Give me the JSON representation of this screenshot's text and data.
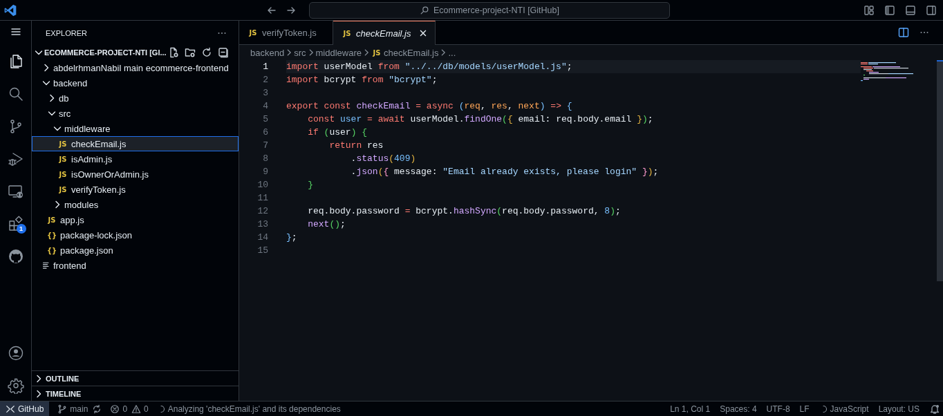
{
  "title_bar": {
    "search": "Ecommerce-project-NTI [GitHub]"
  },
  "activity_bar": {
    "items": [
      {
        "kind": "files",
        "selected": true
      },
      {
        "kind": "search",
        "selected": false
      },
      {
        "kind": "source-control",
        "selected": false
      },
      {
        "kind": "run-debug",
        "selected": false
      },
      {
        "kind": "remote",
        "selected": false
      },
      {
        "kind": "extensions",
        "selected": false,
        "badge": "1"
      },
      {
        "kind": "github",
        "selected": false
      }
    ],
    "bottom": [
      {
        "kind": "account"
      },
      {
        "kind": "settings"
      }
    ]
  },
  "explorer": {
    "title": "EXPLORER",
    "root": {
      "label": "ECOMMERCE-PROJECT-NTI [GI...",
      "expanded": true
    },
    "tree": [
      {
        "label": "abdelrhmanNabil main ecommerce-frontend",
        "kind": "folder",
        "expanded": false,
        "selected": false
      },
      {
        "label": "backend",
        "kind": "folder",
        "expanded": true,
        "selected": false,
        "children": [
          {
            "label": "db",
            "kind": "folder",
            "expanded": false,
            "selected": false
          },
          {
            "label": "src",
            "kind": "folder",
            "expanded": true,
            "selected": false,
            "children": [
              {
                "label": "middleware",
                "kind": "folder",
                "expanded": true,
                "selected": false,
                "children": [
                  {
                    "label": "checkEmail.js",
                    "kind": "file",
                    "icon": "JS",
                    "selected": true
                  },
                  {
                    "label": "isAdmin.js",
                    "kind": "file",
                    "icon": "JS",
                    "selected": false
                  },
                  {
                    "label": "isOwnerOrAdmin.js",
                    "kind": "file",
                    "icon": "JS",
                    "selected": false
                  },
                  {
                    "label": "verifyToken.js",
                    "kind": "file",
                    "icon": "JS",
                    "selected": false
                  }
                ]
              },
              {
                "label": "modules",
                "kind": "folder",
                "expanded": false,
                "selected": false
              }
            ]
          },
          {
            "label": "app.js",
            "kind": "file",
            "icon": "JS",
            "selected": false
          },
          {
            "label": "package-lock.json",
            "kind": "file",
            "icon": "{}",
            "selected": false
          },
          {
            "label": "package.json",
            "kind": "file",
            "icon": "{}",
            "selected": false
          }
        ]
      },
      {
        "label": "frontend",
        "kind": "submodule",
        "selected": false
      }
    ],
    "sections": [
      {
        "label": "OUTLINE",
        "expanded": false
      },
      {
        "label": "TIMELINE",
        "expanded": false
      }
    ]
  },
  "editor": {
    "tabs": [
      {
        "label": "verifyToken.js",
        "icon": "JS",
        "selected": false,
        "preview": false
      },
      {
        "label": "checkEmail.js",
        "icon": "JS",
        "selected": true,
        "preview": true
      }
    ],
    "breadcrumbs": [
      {
        "text": "backend"
      },
      {
        "text": "src"
      },
      {
        "text": "middleware"
      },
      {
        "text": "checkEmail.js",
        "icon": "JS"
      },
      {
        "text": "..."
      }
    ],
    "lines": [
      {
        "number": "1",
        "active": true,
        "tokens": [
          {
            "kind": "kw",
            "text": "import"
          },
          {
            "kind": "plain",
            "text": " userModel "
          },
          {
            "kind": "kw",
            "text": "from"
          },
          {
            "kind": "str",
            "text": " \"../../db/models/userModel.js\""
          },
          {
            "kind": "plain",
            "text": ";"
          }
        ]
      },
      {
        "number": "2",
        "active": false,
        "tokens": [
          {
            "kind": "kw",
            "text": "import"
          },
          {
            "kind": "plain",
            "text": " bcrypt "
          },
          {
            "kind": "kw",
            "text": "from"
          },
          {
            "kind": "str",
            "text": " \"bcrypt\""
          },
          {
            "kind": "plain",
            "text": ";"
          }
        ]
      },
      {
        "number": "3",
        "active": false
      },
      {
        "number": "4",
        "active": false,
        "tokens": [
          {
            "kind": "kw",
            "text": "export"
          },
          {
            "kind": "kw",
            "text": " const"
          },
          {
            "kind": "fn",
            "text": " checkEmail"
          },
          {
            "kind": "kw",
            "text": " ="
          },
          {
            "kind": "kw",
            "text": " async"
          },
          {
            "kind": "b1",
            "text": " ("
          },
          {
            "kind": "param",
            "text": "req"
          },
          {
            "kind": "plain",
            "text": ", "
          },
          {
            "kind": "param",
            "text": "res"
          },
          {
            "kind": "plain",
            "text": ", "
          },
          {
            "kind": "param",
            "text": "next"
          },
          {
            "kind": "b1",
            "text": ")"
          },
          {
            "kind": "kw",
            "text": " =>"
          },
          {
            "kind": "b1",
            "text": " {"
          }
        ]
      },
      {
        "number": "5",
        "active": false,
        "tokens": [
          {
            "kind": "kw",
            "text": "    const"
          },
          {
            "kind": "var",
            "text": " user"
          },
          {
            "kind": "kw",
            "text": " ="
          },
          {
            "kind": "kw",
            "text": " await"
          },
          {
            "kind": "plain",
            "text": " userModel."
          },
          {
            "kind": "fn",
            "text": "findOne"
          },
          {
            "kind": "b2",
            "text": "("
          },
          {
            "kind": "b3",
            "text": "{"
          },
          {
            "kind": "plain",
            "text": " email: req.body.email "
          },
          {
            "kind": "b3",
            "text": "}"
          },
          {
            "kind": "b2",
            "text": ")"
          },
          {
            "kind": "plain",
            "text": ";"
          }
        ]
      },
      {
        "number": "6",
        "active": false,
        "tokens": [
          {
            "kind": "kw",
            "text": "    if"
          },
          {
            "kind": "b2",
            "text": " ("
          },
          {
            "kind": "plain",
            "text": "user"
          },
          {
            "kind": "b2",
            "text": ")"
          },
          {
            "kind": "b2",
            "text": " {"
          }
        ]
      },
      {
        "number": "7",
        "active": false,
        "tokens": [
          {
            "kind": "kw",
            "text": "        return"
          },
          {
            "kind": "plain",
            "text": " res"
          }
        ]
      },
      {
        "number": "8",
        "active": false,
        "tokens": [
          {
            "kind": "plain",
            "text": "            ."
          },
          {
            "kind": "fn",
            "text": "status"
          },
          {
            "kind": "b3",
            "text": "("
          },
          {
            "kind": "num",
            "text": "409"
          },
          {
            "kind": "b3",
            "text": ")"
          }
        ]
      },
      {
        "number": "9",
        "active": false,
        "tokens": [
          {
            "kind": "plain",
            "text": "            ."
          },
          {
            "kind": "fn",
            "text": "json"
          },
          {
            "kind": "b3",
            "text": "("
          },
          {
            "kind": "b4",
            "text": "{"
          },
          {
            "kind": "plain",
            "text": " message: "
          },
          {
            "kind": "str",
            "text": "\"Email already exists, please login\""
          },
          {
            "kind": "b4",
            "text": " }"
          },
          {
            "kind": "b3",
            "text": ")"
          },
          {
            "kind": "plain",
            "text": ";"
          }
        ]
      },
      {
        "number": "10",
        "active": false,
        "tokens": [
          {
            "kind": "b2",
            "text": "    }"
          }
        ]
      },
      {
        "number": "11",
        "active": false
      },
      {
        "number": "12",
        "active": false,
        "tokens": [
          {
            "kind": "plain",
            "text": "    req.body.password "
          },
          {
            "kind": "kw",
            "text": "="
          },
          {
            "kind": "plain",
            "text": " bcrypt."
          },
          {
            "kind": "fn",
            "text": "hashSync"
          },
          {
            "kind": "b2",
            "text": "("
          },
          {
            "kind": "plain",
            "text": "req.body.password, "
          },
          {
            "kind": "num",
            "text": "8"
          },
          {
            "kind": "b2",
            "text": ")"
          },
          {
            "kind": "plain",
            "text": ";"
          }
        ]
      },
      {
        "number": "13",
        "active": false,
        "tokens": [
          {
            "kind": "fn",
            "text": "    next"
          },
          {
            "kind": "b2",
            "text": "()"
          },
          {
            "kind": "plain",
            "text": ";"
          }
        ]
      },
      {
        "number": "14",
        "active": false,
        "tokens": [
          {
            "kind": "b1",
            "text": "}"
          },
          {
            "kind": "plain",
            "text": ";"
          }
        ]
      },
      {
        "number": "15",
        "active": false
      }
    ]
  },
  "status_bar": {
    "left": [
      {
        "kind": "remote",
        "text": "GitHub"
      },
      {
        "kind": "branch",
        "text": "main"
      },
      {
        "kind": "sync"
      },
      {
        "kind": "errors",
        "text": "0"
      },
      {
        "kind": "warnings",
        "text": "0"
      },
      {
        "kind": "progress",
        "text": "Analyzing 'checkEmail.js' and its dependencies"
      }
    ],
    "right": [
      {
        "kind": "text",
        "text": "Ln 1, Col 1"
      },
      {
        "kind": "text",
        "text": "Spaces: 4"
      },
      {
        "kind": "text",
        "text": "UTF-8"
      },
      {
        "kind": "text",
        "text": "LF"
      },
      {
        "kind": "progress",
        "text": "JavaScript"
      },
      {
        "kind": "text",
        "text": "Layout: US"
      },
      {
        "kind": "bell"
      }
    ]
  }
}
